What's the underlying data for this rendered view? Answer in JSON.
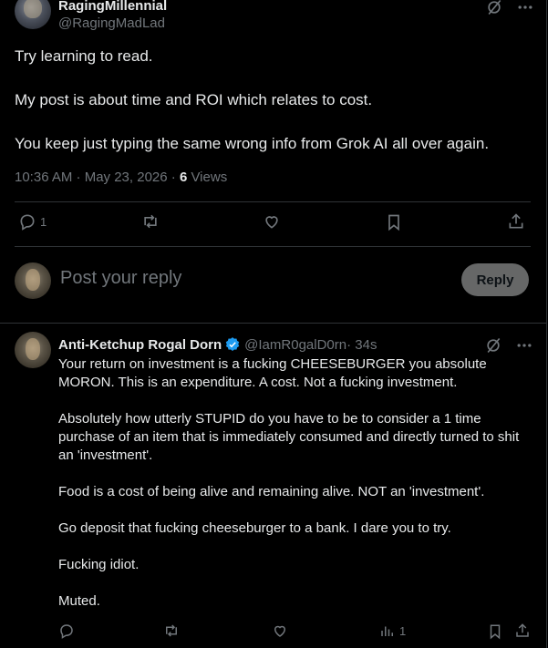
{
  "post": {
    "author_name": "RagingMillennial",
    "author_handle": "@RagingMadLad",
    "paragraphs": [
      "Try learning to read.",
      "My post is about time and ROI which relates to cost.",
      "You keep just typing the same wrong info from Grok AI all over again."
    ],
    "timestamp": "10:36 AM · May 23, 2026 · ",
    "views_count": "6",
    "views_label": " Views",
    "reply_count": "1"
  },
  "composer": {
    "placeholder": "Post your reply",
    "button_label": "Reply"
  },
  "reply": {
    "author_name": "Anti-Ketchup Rogal Dorn",
    "author_handle": "@IamR0galD0rn",
    "time": " · 34s",
    "paragraphs": [
      "Your return on investment is a fucking CHEESEBURGER you absolute MORON. This is an expenditure. A cost. Not a fucking investment.",
      "Absolutely how utterly STUPID do you have to be to consider a 1 time purchase of an item that is immediately consumed and directly turned to shit an 'investment'.",
      "Food is a cost of being alive and remaining alive. NOT an 'investment'.",
      "Go deposit that fucking cheeseburger to a bank. I dare you to try.",
      "Fucking idiot.",
      "Muted."
    ],
    "views_count": "1"
  },
  "colors": {
    "background": "#000000",
    "text": "#e7e9ea",
    "muted": "#71767b",
    "divider": "#2f3336",
    "verified": "#1d9bf0"
  },
  "icons": [
    "grok-icon",
    "more-icon",
    "reply-icon",
    "repost-icon",
    "like-icon",
    "bookmark-icon",
    "share-icon",
    "views-icon",
    "verified-badge-icon"
  ]
}
